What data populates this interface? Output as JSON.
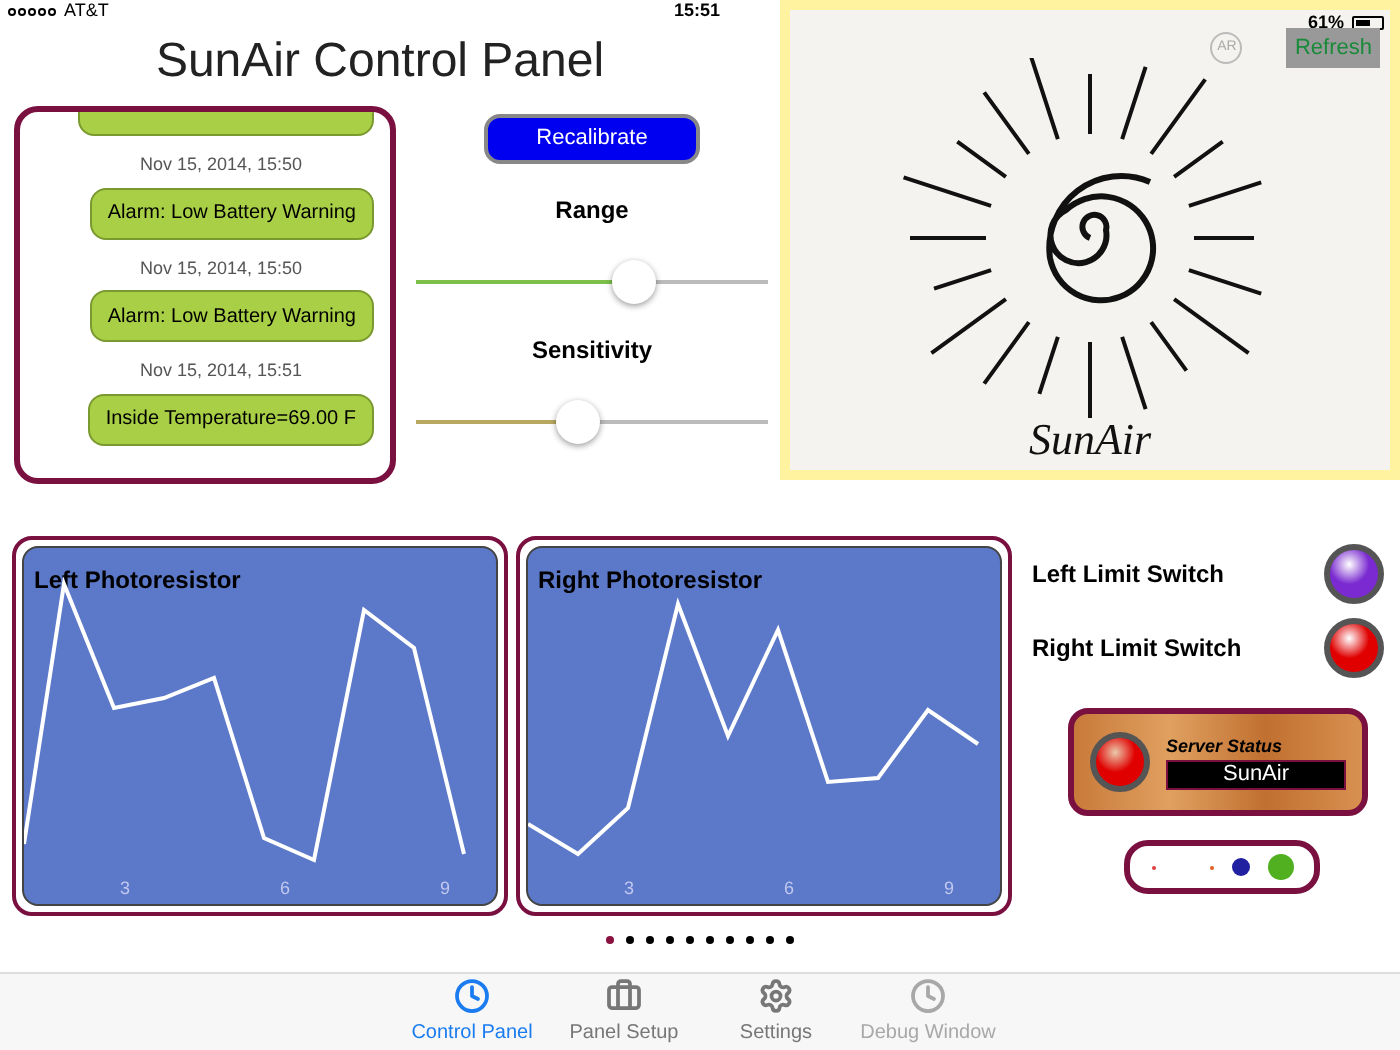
{
  "status_bar": {
    "carrier": "AT&T",
    "time": "15:51",
    "battery": "61%"
  },
  "title": "SunAir Control Panel",
  "messages": [
    {
      "kind": "cut"
    },
    {
      "kind": "full",
      "time": "Nov 15, 2014, 15:50",
      "text": "Alarm:  Low Battery Warning"
    },
    {
      "kind": "full",
      "time": "Nov 15, 2014, 15:50",
      "text": "Alarm:  Low Battery Warning"
    },
    {
      "kind": "full",
      "time": "Nov 15, 2014, 15:51",
      "text": "Inside Temperature=69.00 F"
    }
  ],
  "recalibrate_button": "Recalibrate",
  "sliders": [
    {
      "label": "Range",
      "level": 0.62,
      "color": "#7cc04a"
    },
    {
      "label": "Sensitivity",
      "level": 0.46,
      "color": "#b8a860"
    }
  ],
  "logo": {
    "badge": "AR",
    "refresh_button": "Refresh",
    "wordmark": "SunAir"
  },
  "charts": [
    {
      "title": "Left Photoresistor",
      "x_tick_labels": [
        "3",
        "6",
        "9"
      ]
    },
    {
      "title": "Right Photoresistor",
      "x_tick_labels": [
        "3",
        "6",
        "9"
      ]
    }
  ],
  "limit_switches": [
    {
      "label": "Left Limit Switch",
      "color": "#7a2ad0"
    },
    {
      "label": "Right Limit Switch",
      "color": "#e00000"
    }
  ],
  "server_status": {
    "label": "Server Status",
    "value": "SunAir",
    "color": "#e00000"
  },
  "indicator_dots": [
    {
      "color": "#e04040"
    },
    {
      "color": "#e06020"
    },
    {
      "color": "#2020a0"
    },
    {
      "color": "#50b020"
    }
  ],
  "page_dots": [
    {
      "selected": true
    },
    {
      "selected": false
    },
    {
      "selected": false
    },
    {
      "selected": false
    },
    {
      "selected": false
    },
    {
      "selected": false
    },
    {
      "selected": false
    },
    {
      "selected": false
    },
    {
      "selected": false
    },
    {
      "selected": false
    }
  ],
  "tabs": [
    {
      "label": "Control Panel",
      "selected": true,
      "disabled": false
    },
    {
      "label": "Panel Setup",
      "selected": false,
      "disabled": false
    },
    {
      "label": "Settings",
      "selected": false,
      "disabled": false
    },
    {
      "label": "Debug Window",
      "selected": false,
      "disabled": true
    }
  ]
}
